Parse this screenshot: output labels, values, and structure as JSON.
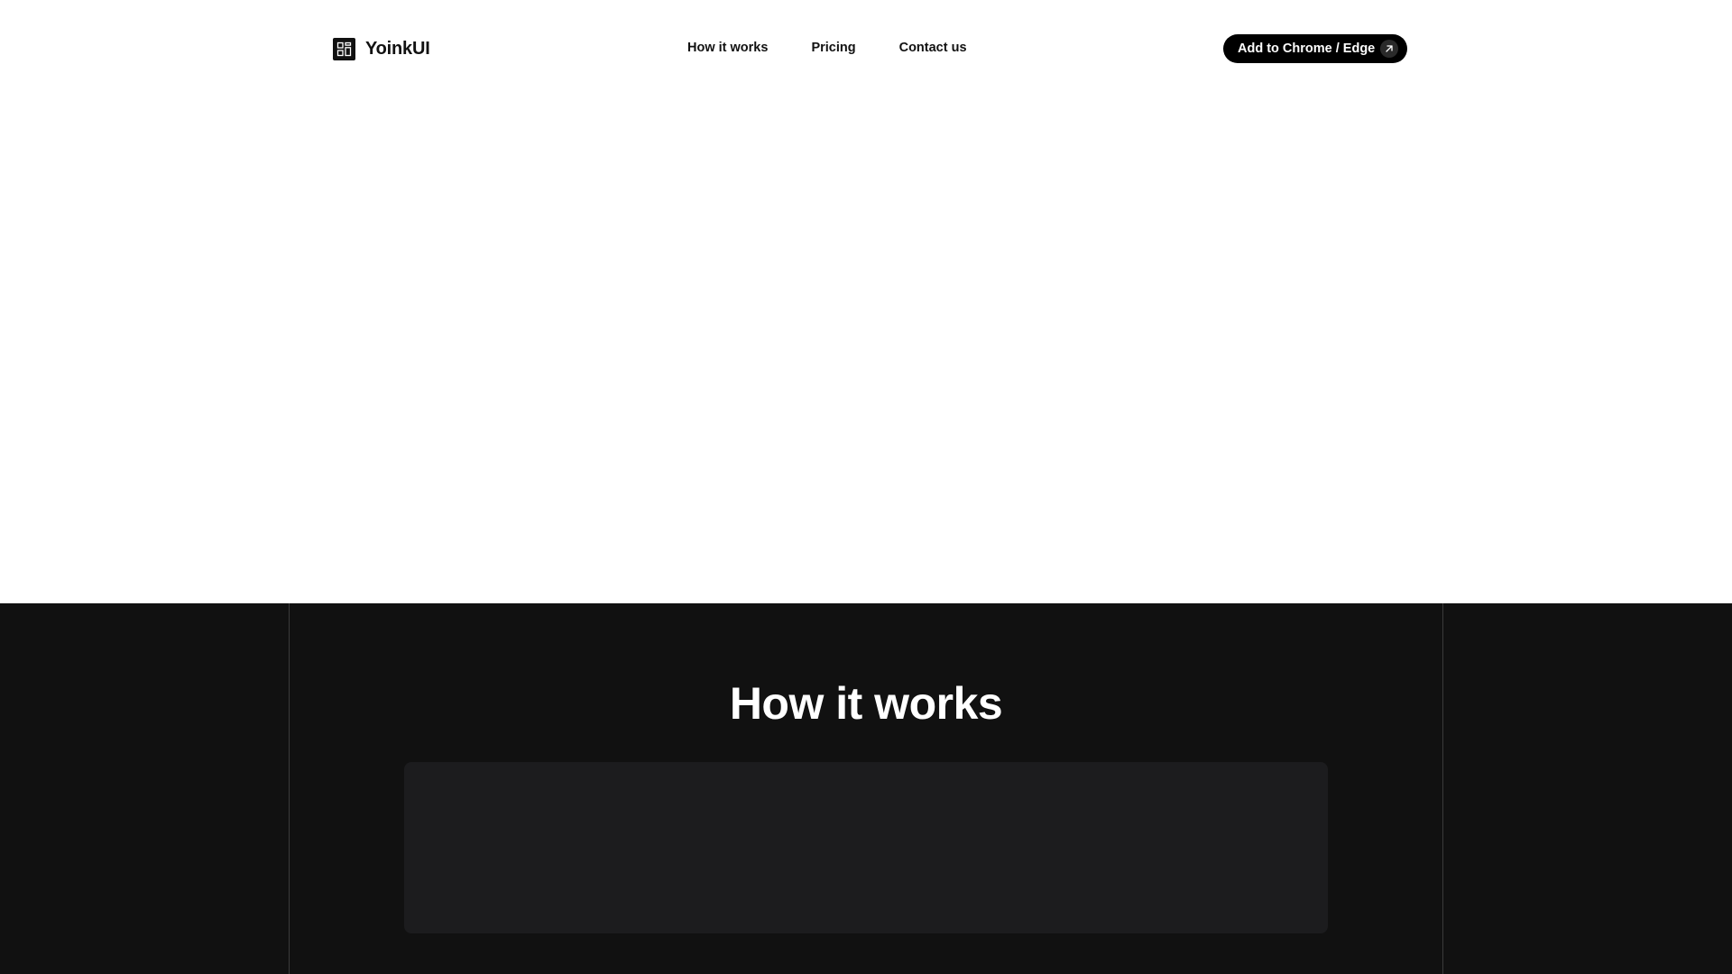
{
  "header": {
    "logo": {
      "icon": "grid-logo-icon",
      "name": "YoinkUI"
    },
    "nav": [
      {
        "label": "How it works"
      },
      {
        "label": "Pricing"
      },
      {
        "label": "Contact us"
      }
    ],
    "cta": {
      "label": "Add to Chrome / Edge",
      "icon": "arrow-up-right-icon"
    }
  },
  "how_it_works": {
    "title": "How it works"
  },
  "colors": {
    "background": "#ffffff",
    "text": "#111111",
    "cta_background": "#000000",
    "dark_section": "#111111",
    "card": "#1c1c1e",
    "guide_line": "#3a3a3a"
  }
}
